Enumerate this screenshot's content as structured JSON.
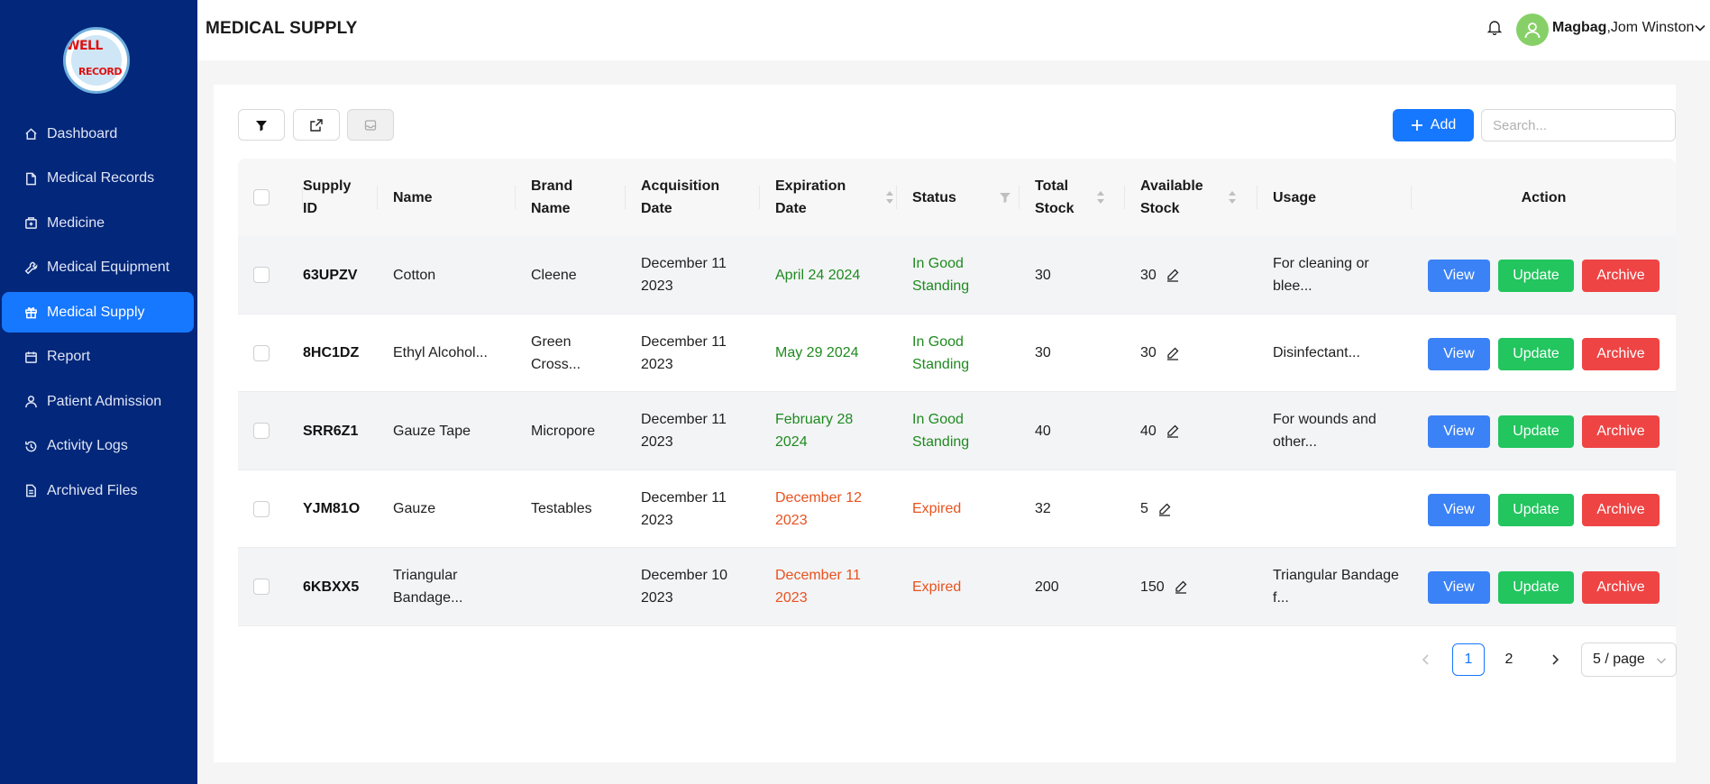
{
  "app": {
    "logo_line1": "WELL",
    "logo_line2": "RECORD"
  },
  "sidebar": {
    "items": [
      {
        "label": "Dashboard",
        "icon": "home-icon",
        "active": false
      },
      {
        "label": "Medical Records",
        "icon": "file-icon",
        "active": false
      },
      {
        "label": "Medicine",
        "icon": "medicine-box-icon",
        "active": false
      },
      {
        "label": "Medical Equipment",
        "icon": "tool-icon",
        "active": false
      },
      {
        "label": "Medical Supply",
        "icon": "gift-icon",
        "active": true
      },
      {
        "label": "Report",
        "icon": "calendar-icon",
        "active": false
      },
      {
        "label": "Patient Admission",
        "icon": "user-icon",
        "active": false
      },
      {
        "label": "Activity Logs",
        "icon": "history-icon",
        "active": false
      },
      {
        "label": "Archived Files",
        "icon": "file-text-icon",
        "active": false
      }
    ]
  },
  "header": {
    "title": "MEDICAL SUPPLY",
    "user_last": "Magbag",
    "user_first": ",Jom Winston"
  },
  "toolbar": {
    "add_label": "Add",
    "search_placeholder": "Search..."
  },
  "table": {
    "columns": {
      "supply_id": "Supply ID",
      "name": "Name",
      "brand_name": "Brand Name",
      "acquisition_date": "Acquisition Date",
      "expiration_date": "Expiration Date",
      "status": "Status",
      "total_stock": "Total Stock",
      "available_stock": "Available Stock",
      "usage": "Usage",
      "action": "Action"
    },
    "rows": [
      {
        "id": "63UPZV",
        "name": "Cotton",
        "brand": "Cleene",
        "acq": "December 11 2023",
        "exp": "April 24 2024",
        "status": "In Good Standing",
        "total": "30",
        "available": "30",
        "usage": "For cleaning or blee..."
      },
      {
        "id": "8HC1DZ",
        "name": "Ethyl Alcohol...",
        "brand": "Green Cross...",
        "acq": "December 11 2023",
        "exp": "May 29 2024",
        "status": "In Good Standing",
        "total": "30",
        "available": "30",
        "usage": "Disinfectant..."
      },
      {
        "id": "SRR6Z1",
        "name": "Gauze Tape",
        "brand": "Micropore",
        "acq": "December 11 2023",
        "exp": "February 28 2024",
        "status": "In Good Standing",
        "total": "40",
        "available": "40",
        "usage": "For wounds and other..."
      },
      {
        "id": "YJM81O",
        "name": "Gauze",
        "brand": "Testables",
        "acq": "December 11 2023",
        "exp": "December 12 2023",
        "status": "Expired",
        "total": "32",
        "available": "5",
        "usage": ""
      },
      {
        "id": "6KBXX5",
        "name": "Triangular Bandage...",
        "brand": "",
        "acq": "December 10 2023",
        "exp": "December 11 2023",
        "status": "Expired",
        "total": "200",
        "available": "150",
        "usage": "Triangular Bandage f..."
      }
    ],
    "actions": {
      "view": "View",
      "update": "Update",
      "archive": "Archive"
    }
  },
  "pagination": {
    "pages": [
      "1",
      "2"
    ],
    "current": "1",
    "page_size": "5 / page"
  },
  "colors": {
    "sidebar_bg": "#03277a",
    "accent": "#1677ff",
    "good": "#1f8a1f",
    "expired": "#e8521f",
    "view": "#3b82f6",
    "update": "#22c55e",
    "archive": "#ef4444"
  }
}
